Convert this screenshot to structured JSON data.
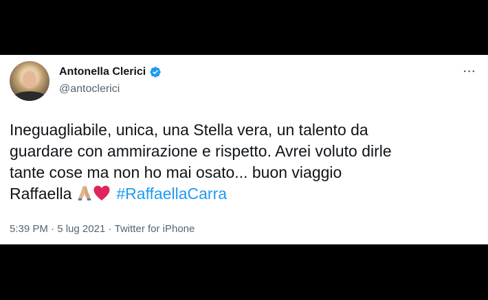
{
  "user": {
    "display_name": "Antonella Clerici",
    "handle": "@antoclerici",
    "verified_icon": "verified-badge-icon",
    "avatar": "profile-photo"
  },
  "more_label": "···",
  "tweet": {
    "lines": [
      "Ineguagliabile, unica, una Stella vera, un talento da",
      "guardare con ammirazione e rispetto. Avrei voluto dirle",
      "tante cose ma non ho mai osato... buon viaggio"
    ],
    "last_line_text": "Raffaella",
    "emojis": [
      "folded-hands-emoji",
      "red-heart-emoji"
    ],
    "hashtag": "#RaffaellaCarra"
  },
  "meta": {
    "time": "5:39 PM",
    "separator": "·",
    "date": "5 lug 2021",
    "source": "Twitter for iPhone"
  },
  "colors": {
    "background": "#000000",
    "card": "#ffffff",
    "text": "#0f1419",
    "secondary": "#536471",
    "accent": "#1d9bf0",
    "heart": "#e0245e"
  }
}
